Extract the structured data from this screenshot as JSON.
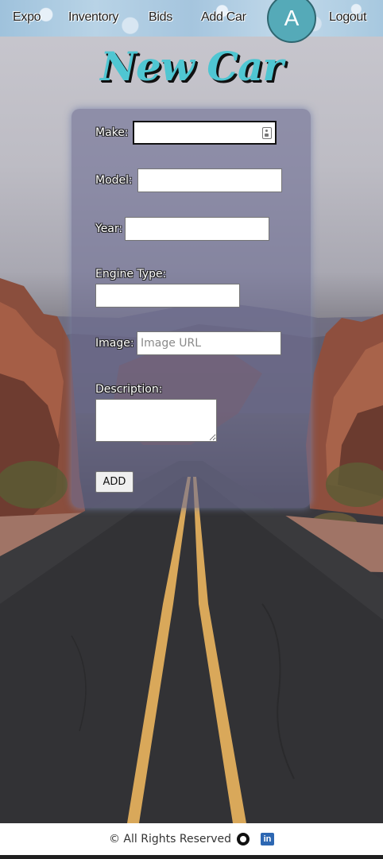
{
  "nav": {
    "links": [
      "Expo",
      "Inventory",
      "Bids",
      "Add Car",
      "Logout"
    ],
    "avatar_initial": "A"
  },
  "page_title": "New Car",
  "form": {
    "make_label": "Make:",
    "model_label": "Model:",
    "year_label": "Year:",
    "engine_label": "Engine Type:",
    "image_label": "Image:",
    "image_placeholder": "Image URL",
    "description_label": "Description:",
    "submit_label": "ADD"
  },
  "footer": {
    "copyright": "© All Rights Reserved",
    "linkedin_text": "in"
  },
  "colors": {
    "title": "#4fc6d2",
    "avatar": "#55aab8",
    "card": "#707094",
    "linkedin": "#2d67b2"
  },
  "icons": [
    "contact-card-icon",
    "github-icon",
    "linkedin-icon"
  ]
}
